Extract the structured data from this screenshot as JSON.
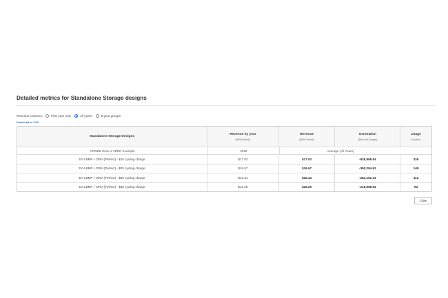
{
  "dialog": {
    "title": "Detailed metrics for Standalone Storage designs",
    "revenue_columns_label": "Revenue columns:",
    "options": [
      "First year only",
      "All years",
      "5-year groups"
    ],
    "selected_option": "All years",
    "download_label": "Download as CSV",
    "close_label": "Close"
  },
  "table": {
    "headers": [
      {
        "title": "Standalone Storage Designs",
        "unit": ""
      },
      {
        "title": "Revenue by year",
        "unit": "($/kW-Month)"
      },
      {
        "title": "Revenue",
        "unit": "($/kW-Month)"
      },
      {
        "title": "Generation",
        "unit": "(kWh Net Usage)"
      },
      {
        "title": "Usage",
        "unit": "(Cycles)"
      }
    ],
    "subheader": {
      "project": "CONED Zone J VDER Example",
      "year": "2025",
      "range": "Average (All Years)"
    },
    "rows": [
      [
        "DA LBMP + DRV (Perfect) - $15 cycling charge",
        "$17.03",
        "$17.03",
        "-529,968.54",
        "226"
      ],
      [
        "DA LBMP + DRV (Perfect) - $20 cycling charge",
        "$16.67",
        "$16.67",
        "-350,294.63",
        "149"
      ],
      [
        "DA LBMP + DRV (Perfect) - $25 cycling charge",
        "$16.44",
        "$16.44",
        "-262,151.13",
        "112"
      ],
      [
        "DA LBMP + DRV (Perfect) - $30 cycling charge",
        "$16.29",
        "$16.29",
        "-218,955.54",
        "93"
      ]
    ]
  },
  "colors": {
    "accent": "#1a73e8",
    "link": "#1a6fd8",
    "header_bg": "#f7f7f7",
    "border": "#cfcfcf"
  }
}
